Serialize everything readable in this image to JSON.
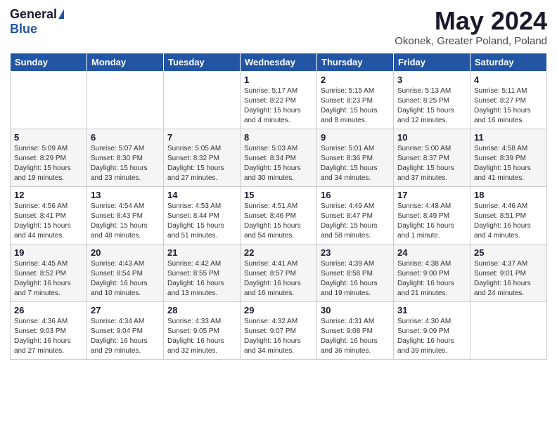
{
  "header": {
    "logo_general": "General",
    "logo_blue": "Blue",
    "title": "May 2024",
    "subtitle": "Okonek, Greater Poland, Poland"
  },
  "days_of_week": [
    "Sunday",
    "Monday",
    "Tuesday",
    "Wednesday",
    "Thursday",
    "Friday",
    "Saturday"
  ],
  "weeks": [
    [
      {
        "day": "",
        "info": ""
      },
      {
        "day": "",
        "info": ""
      },
      {
        "day": "",
        "info": ""
      },
      {
        "day": "1",
        "info": "Sunrise: 5:17 AM\nSunset: 8:22 PM\nDaylight: 15 hours\nand 4 minutes."
      },
      {
        "day": "2",
        "info": "Sunrise: 5:15 AM\nSunset: 8:23 PM\nDaylight: 15 hours\nand 8 minutes."
      },
      {
        "day": "3",
        "info": "Sunrise: 5:13 AM\nSunset: 8:25 PM\nDaylight: 15 hours\nand 12 minutes."
      },
      {
        "day": "4",
        "info": "Sunrise: 5:11 AM\nSunset: 8:27 PM\nDaylight: 15 hours\nand 16 minutes."
      }
    ],
    [
      {
        "day": "5",
        "info": "Sunrise: 5:09 AM\nSunset: 8:29 PM\nDaylight: 15 hours\nand 19 minutes."
      },
      {
        "day": "6",
        "info": "Sunrise: 5:07 AM\nSunset: 8:30 PM\nDaylight: 15 hours\nand 23 minutes."
      },
      {
        "day": "7",
        "info": "Sunrise: 5:05 AM\nSunset: 8:32 PM\nDaylight: 15 hours\nand 27 minutes."
      },
      {
        "day": "8",
        "info": "Sunrise: 5:03 AM\nSunset: 8:34 PM\nDaylight: 15 hours\nand 30 minutes."
      },
      {
        "day": "9",
        "info": "Sunrise: 5:01 AM\nSunset: 8:36 PM\nDaylight: 15 hours\nand 34 minutes."
      },
      {
        "day": "10",
        "info": "Sunrise: 5:00 AM\nSunset: 8:37 PM\nDaylight: 15 hours\nand 37 minutes."
      },
      {
        "day": "11",
        "info": "Sunrise: 4:58 AM\nSunset: 8:39 PM\nDaylight: 15 hours\nand 41 minutes."
      }
    ],
    [
      {
        "day": "12",
        "info": "Sunrise: 4:56 AM\nSunset: 8:41 PM\nDaylight: 15 hours\nand 44 minutes."
      },
      {
        "day": "13",
        "info": "Sunrise: 4:54 AM\nSunset: 8:43 PM\nDaylight: 15 hours\nand 48 minutes."
      },
      {
        "day": "14",
        "info": "Sunrise: 4:53 AM\nSunset: 8:44 PM\nDaylight: 15 hours\nand 51 minutes."
      },
      {
        "day": "15",
        "info": "Sunrise: 4:51 AM\nSunset: 8:46 PM\nDaylight: 15 hours\nand 54 minutes."
      },
      {
        "day": "16",
        "info": "Sunrise: 4:49 AM\nSunset: 8:47 PM\nDaylight: 15 hours\nand 58 minutes."
      },
      {
        "day": "17",
        "info": "Sunrise: 4:48 AM\nSunset: 8:49 PM\nDaylight: 16 hours\nand 1 minute."
      },
      {
        "day": "18",
        "info": "Sunrise: 4:46 AM\nSunset: 8:51 PM\nDaylight: 16 hours\nand 4 minutes."
      }
    ],
    [
      {
        "day": "19",
        "info": "Sunrise: 4:45 AM\nSunset: 8:52 PM\nDaylight: 16 hours\nand 7 minutes."
      },
      {
        "day": "20",
        "info": "Sunrise: 4:43 AM\nSunset: 8:54 PM\nDaylight: 16 hours\nand 10 minutes."
      },
      {
        "day": "21",
        "info": "Sunrise: 4:42 AM\nSunset: 8:55 PM\nDaylight: 16 hours\nand 13 minutes."
      },
      {
        "day": "22",
        "info": "Sunrise: 4:41 AM\nSunset: 8:57 PM\nDaylight: 16 hours\nand 16 minutes."
      },
      {
        "day": "23",
        "info": "Sunrise: 4:39 AM\nSunset: 8:58 PM\nDaylight: 16 hours\nand 19 minutes."
      },
      {
        "day": "24",
        "info": "Sunrise: 4:38 AM\nSunset: 9:00 PM\nDaylight: 16 hours\nand 21 minutes."
      },
      {
        "day": "25",
        "info": "Sunrise: 4:37 AM\nSunset: 9:01 PM\nDaylight: 16 hours\nand 24 minutes."
      }
    ],
    [
      {
        "day": "26",
        "info": "Sunrise: 4:36 AM\nSunset: 9:03 PM\nDaylight: 16 hours\nand 27 minutes."
      },
      {
        "day": "27",
        "info": "Sunrise: 4:34 AM\nSunset: 9:04 PM\nDaylight: 16 hours\nand 29 minutes."
      },
      {
        "day": "28",
        "info": "Sunrise: 4:33 AM\nSunset: 9:05 PM\nDaylight: 16 hours\nand 32 minutes."
      },
      {
        "day": "29",
        "info": "Sunrise: 4:32 AM\nSunset: 9:07 PM\nDaylight: 16 hours\nand 34 minutes."
      },
      {
        "day": "30",
        "info": "Sunrise: 4:31 AM\nSunset: 9:08 PM\nDaylight: 16 hours\nand 36 minutes."
      },
      {
        "day": "31",
        "info": "Sunrise: 4:30 AM\nSunset: 9:09 PM\nDaylight: 16 hours\nand 39 minutes."
      },
      {
        "day": "",
        "info": ""
      }
    ]
  ]
}
